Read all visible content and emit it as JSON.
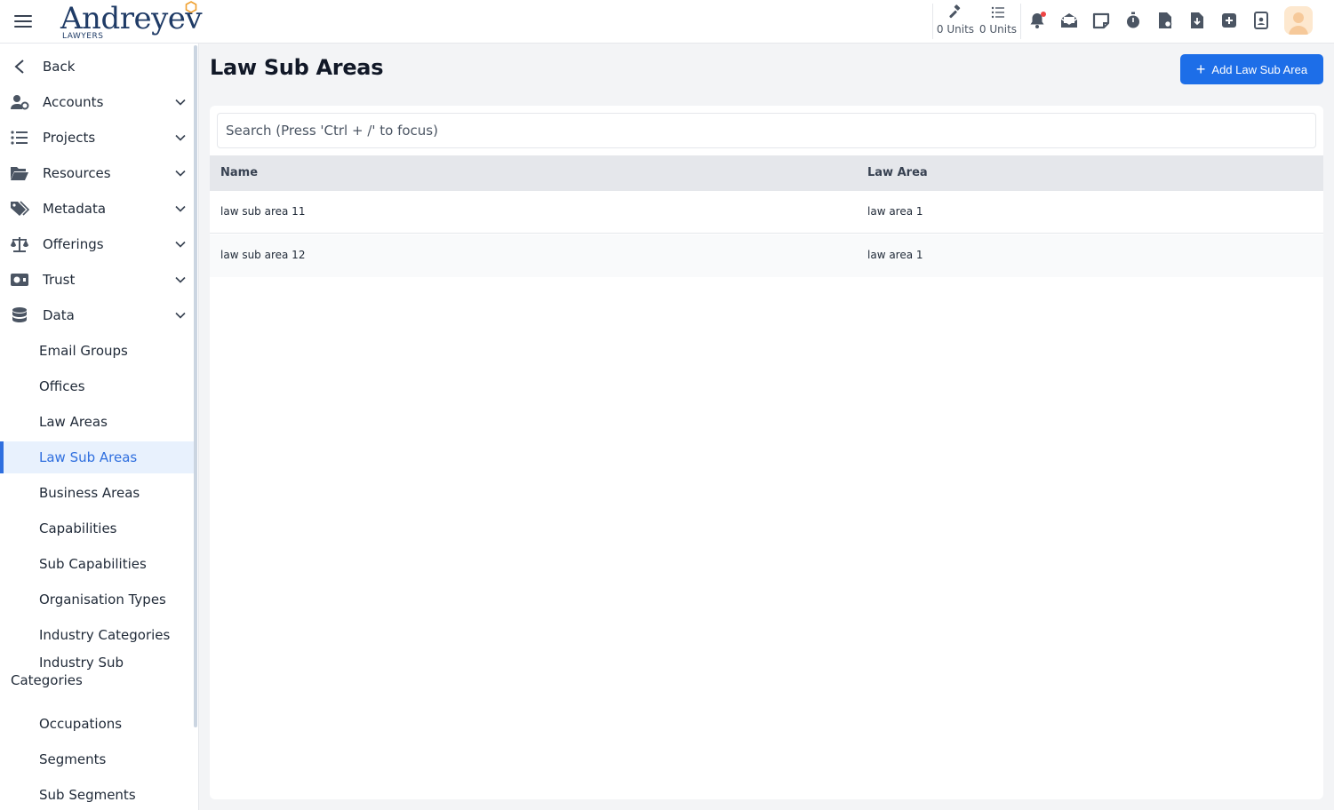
{
  "header": {
    "logo_text": "Andreyev",
    "logo_subtext": "LAWYERS",
    "units_a": "0 Units",
    "units_b": "0 Units",
    "notification_dot_color": "#ef4444",
    "icons": [
      "gavel-icon",
      "list-icon",
      "bell-icon",
      "mail-open-icon",
      "note-icon",
      "stopwatch-icon",
      "file-search-icon",
      "file-download-icon",
      "plus-square-icon",
      "id-badge-icon"
    ]
  },
  "sidebar": {
    "back_label": "Back",
    "sections": [
      {
        "label": "Accounts",
        "icon": "user-gear-icon"
      },
      {
        "label": "Projects",
        "icon": "list-icon"
      },
      {
        "label": "Resources",
        "icon": "folder-open-icon"
      },
      {
        "label": "Metadata",
        "icon": "tags-icon"
      },
      {
        "label": "Offerings",
        "icon": "scales-icon"
      },
      {
        "label": "Trust",
        "icon": "money-icon"
      },
      {
        "label": "Data",
        "icon": "database-icon"
      }
    ],
    "data_items": [
      {
        "label": "Email Groups"
      },
      {
        "label": "Offices"
      },
      {
        "label": "Law Areas"
      },
      {
        "label": "Law Sub Areas",
        "active": true
      },
      {
        "label": "Business Areas"
      },
      {
        "label": "Capabilities"
      },
      {
        "label": "Sub Capabilities"
      },
      {
        "label": "Organisation Types"
      },
      {
        "label": "Industry Categories"
      },
      {
        "label": "Industry Sub Categories"
      },
      {
        "label": "Occupations"
      },
      {
        "label": "Segments"
      },
      {
        "label": "Sub Segments"
      }
    ],
    "accent_color": "#2f6fdf"
  },
  "main": {
    "title": "Law Sub Areas",
    "add_button_label": "Add Law Sub Area",
    "search_placeholder": "Search (Press 'Ctrl + /' to focus)",
    "columns": [
      "Name",
      "Law Area"
    ],
    "rows": [
      {
        "name": "law sub area 11",
        "law_area": "law area 1"
      },
      {
        "name": "law sub area 12",
        "law_area": "law area 1"
      }
    ],
    "button_color": "#1d6ee8"
  }
}
